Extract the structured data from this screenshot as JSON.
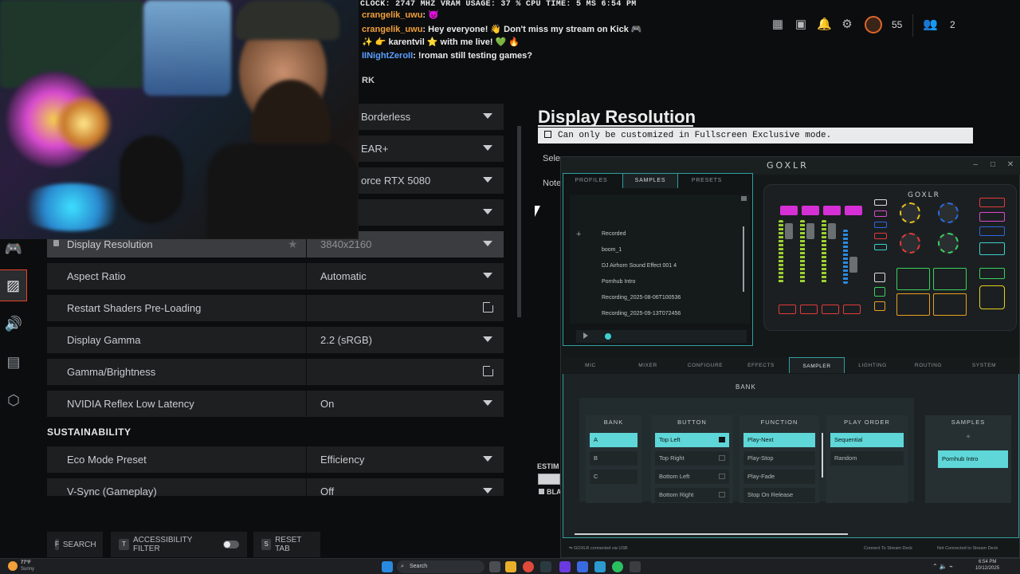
{
  "perf_overlay": {
    "line": "CLOCK: 2747 MHZ  VRAM USAGE: 37 %  CPU TIME:  5 MS  6:54 PM"
  },
  "chat": [
    {
      "user": "crangelik_uwu",
      "sep": ": ",
      "text": "😈"
    },
    {
      "user": "crangelik_uwu",
      "sep": ": ",
      "text": "Hey everyone! 👋 Don't miss my stream on Kick 🎮"
    },
    {
      "user": "",
      "sep": "",
      "text": "✨ 👉 karentvil ⭐ with me live! 💚 🔥"
    },
    {
      "user": "IINightZeroII",
      "sep": ": ",
      "text": "!roman still testing games?"
    }
  ],
  "chat_fragment": "RK",
  "hud": {
    "level": "55",
    "friends": "2",
    "icons": [
      "apps-grid-icon",
      "chat-icon",
      "bell-icon",
      "gear-icon",
      "prestige-badge-icon",
      "friends-icon"
    ]
  },
  "settings": {
    "rows": [
      {
        "label": "",
        "value": "Borderless",
        "control": "dropdown"
      },
      {
        "label": "",
        "value": "EAR+",
        "control": "dropdown"
      },
      {
        "label": "",
        "value": "orce RTX 5080",
        "control": "dropdown"
      },
      {
        "label": "",
        "value": "",
        "control": "dropdown"
      },
      {
        "label": "Display Resolution",
        "value": "3840x2160",
        "control": "dropdown",
        "locked": true
      },
      {
        "label": "Aspect Ratio",
        "value": "Automatic",
        "control": "dropdown"
      },
      {
        "label": "Restart Shaders Pre-Loading",
        "value": "",
        "control": "external"
      },
      {
        "label": "Display Gamma",
        "value": "2.2 (sRGB)",
        "control": "dropdown"
      },
      {
        "label": "Gamma/Brightness",
        "value": "",
        "control": "external"
      },
      {
        "label": "NVIDIA Reflex Low Latency",
        "value": "On",
        "control": "dropdown"
      }
    ],
    "section": "SUSTAINABILITY",
    "rows2": [
      {
        "label": "Eco Mode Preset",
        "value": "Efficiency",
        "control": "dropdown"
      },
      {
        "label": "V-Sync (Gameplay)",
        "value": "Off",
        "control": "dropdown"
      }
    ]
  },
  "detail": {
    "title": "Display Resolution",
    "notice": "Can only be customized in Fullscreen Exclusive mode.",
    "frag_sele": "Sele",
    "frag_note": "Note",
    "frag_estim": "ESTIM",
    "frag_bla": "BLA"
  },
  "bottom": {
    "search_key": "F",
    "search": "SEARCH",
    "access_key": "T",
    "access": "ACCESSIBILITY FILTER",
    "reset_key": "S",
    "reset": "RESET TAB"
  },
  "goxlr": {
    "logo": "GOXLR",
    "device_logo": "GOXLR",
    "tabs": [
      "PROFILES",
      "SAMPLES",
      "PRESETS"
    ],
    "samples": [
      "Recorded",
      "boom_1",
      "DJ Airhorn Sound Effect 001 4",
      "Pornhub Intro",
      "Recording_2025-08-06T100536",
      "Recording_2025-09-13T072456"
    ],
    "nav": [
      "MIC",
      "MIXER",
      "CONFIGURE",
      "EFFECTS",
      "SAMPLER",
      "LIGHTING",
      "ROUTING",
      "SYSTEM"
    ],
    "bank_title": "BANK",
    "col_bank": "BANK",
    "col_button": "BUTTON",
    "col_function": "FUNCTION",
    "col_play_order": "PLAY ORDER",
    "col_samples": "SAMPLES",
    "banks": [
      "A",
      "B",
      "C"
    ],
    "buttons": [
      "Top Left",
      "Top Right",
      "Bottom Left",
      "Bottom Right"
    ],
    "functions": [
      "Play-Next",
      "Play-Stop",
      "Play-Fade",
      "Stop On Release"
    ],
    "play_orders": [
      "Sequential",
      "Random"
    ],
    "sample_assigned": "Pornhub Intro",
    "add_symbol": "+",
    "status_left": "GOXLR connected via USB",
    "status_mid": "Connect To Stream Deck",
    "status_right": "Not Connected to Stream Deck",
    "accent": "#5fd6d8"
  },
  "taskbar": {
    "weather_temp": "77°F",
    "weather_cond": "Sunny",
    "search": "Search",
    "time": "6:54 PM",
    "date": "10/12/2025"
  }
}
